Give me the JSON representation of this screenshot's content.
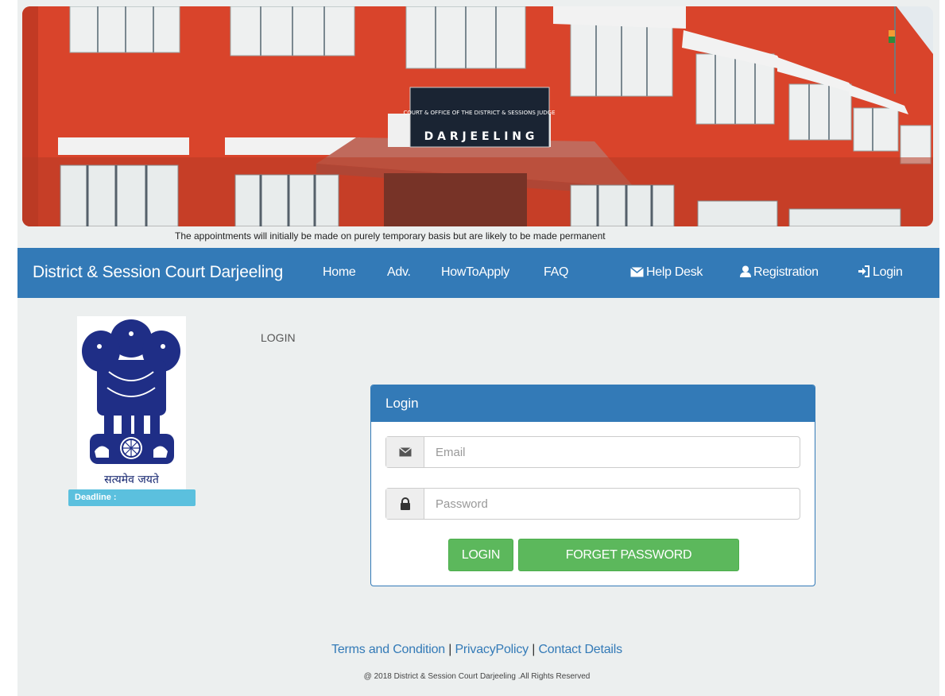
{
  "notice": "The appointments will initially be made on purely temporary basis but are likely to be made permanent",
  "banner": {
    "sign_top": "COURT & OFFICE OF THE DISTRICT & SESSIONS JUDGE",
    "sign_bottom": "D A R J E E L I N G"
  },
  "navbar": {
    "brand": "District & Session Court Darjeeling",
    "items": [
      {
        "label": "Home",
        "icon": ""
      },
      {
        "label": "Adv.",
        "icon": ""
      },
      {
        "label": "HowToApply",
        "icon": ""
      },
      {
        "label": "FAQ",
        "icon": ""
      },
      {
        "label": "Help Desk",
        "icon": "envelope-icon"
      },
      {
        "label": "Registration",
        "icon": "user-icon"
      },
      {
        "label": "Login",
        "icon": "log-in-icon"
      }
    ]
  },
  "emblem": {
    "motto": "सत्यमेव जयते"
  },
  "deadline_label": "Deadline :",
  "page_heading": "LOGIN",
  "login_panel": {
    "title": "Login",
    "email_placeholder": "Email",
    "password_placeholder": "Password",
    "login_button": "LOGIN",
    "forget_button": "FORGET PASSWORD"
  },
  "footer": {
    "terms": "Terms and Condition",
    "privacy": "PrivacyPolicy",
    "contact": "Contact Details",
    "separator": " | ",
    "copyright": "@ 2018 District & Session Court Darjeeling .All Rights Reserved"
  },
  "colors": {
    "primary": "#337ab7",
    "success": "#5cb85c",
    "info": "#5bc0de",
    "building": "#d9442b"
  }
}
